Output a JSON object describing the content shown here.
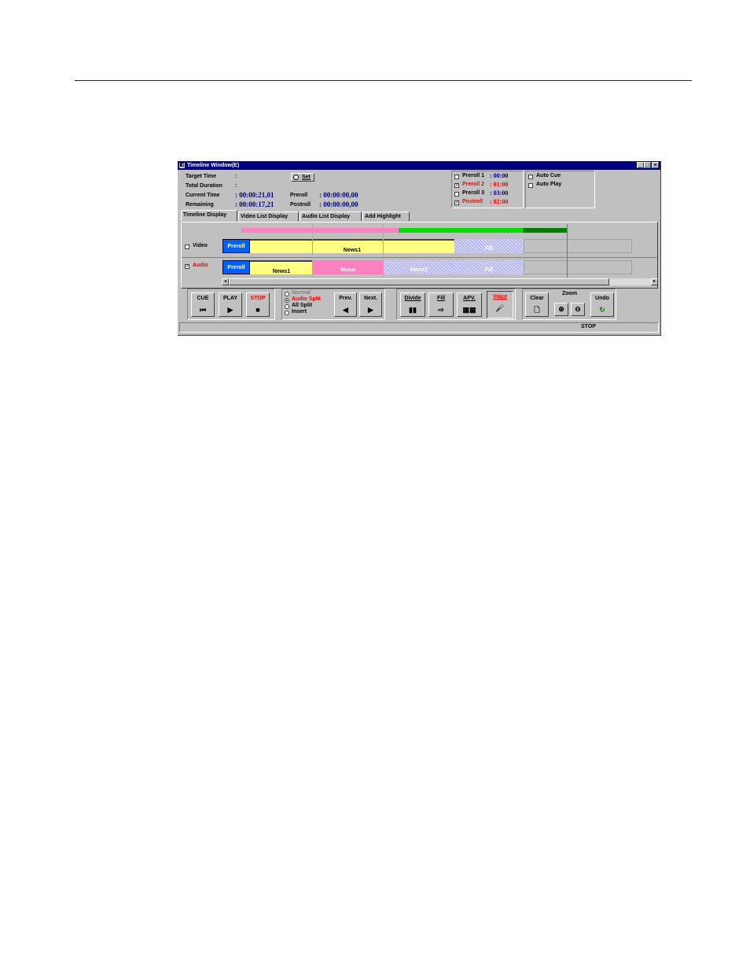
{
  "window": {
    "title": "Timeline Window(E)",
    "min": "_",
    "max": "□",
    "close": "×"
  },
  "info": {
    "target_time_label": "Target Time",
    "total_duration_label": "Total Duration",
    "current_time_label": "Current Time",
    "remaining_label": "Remaining",
    "colon": ":",
    "current_time_value": ": 00:00:21,01",
    "remaining_value": ": 00:00:17,21",
    "preroll_label": "Preroll",
    "postroll_label": "Postroll",
    "preroll_value": ": 00:00:00,00",
    "postroll_value": ": 00:00:00,00",
    "set_button": "Set"
  },
  "prerolls": [
    {
      "label": "Preroll 1",
      "value": ": 00:00",
      "checked": false,
      "color": "#000000",
      "value_color": "#000080"
    },
    {
      "label": "Preroll 2",
      "value": ": 01:00",
      "checked": true,
      "color": "#ff0000",
      "value_color": "#ff0000"
    },
    {
      "label": "Preroll 3",
      "value": ": 03:00",
      "checked": false,
      "color": "#000000",
      "value_color": "#000080"
    },
    {
      "label": "Postroll",
      "value": ": 02:00",
      "checked": true,
      "color": "#ff0000",
      "value_color": "#ff0000"
    }
  ],
  "auto": {
    "cue": "Auto Cue",
    "play": "Auto Play"
  },
  "tabs": [
    "Timeline Display",
    "Video List Display",
    "Audio List Display",
    "Add Highlight"
  ],
  "tracks": {
    "video": {
      "label": "Video",
      "checked": false,
      "preroll": "Preroll",
      "clip1": "News1",
      "clip2": "Fill"
    },
    "audio": {
      "label": "Audio",
      "checked": true,
      "preroll": "Preroll",
      "clip1": "News1",
      "clip2": "Music",
      "clip3": "News1",
      "clip4": "Fill"
    }
  },
  "scroll": {
    "left": "◂",
    "right": "▸"
  },
  "toolbar": {
    "cue": "CUE",
    "cue_icon": "⏮",
    "play": "PLAY",
    "play_icon": "▶",
    "stop": "STOP",
    "stop_icon": "■",
    "modes": [
      "Normal",
      "Audio Split",
      "All Split",
      "Insert"
    ],
    "prev": "Prev.",
    "prev_icon": "◀",
    "next": "Next.",
    "next_icon": "▶",
    "divide": "Divide",
    "divide_icon": "▮▮",
    "fill": "Fill",
    "fill_icon": "⇨",
    "apv": "APV.",
    "apv_icon": "▦▦",
    "voice": "Voice",
    "voice_icon": "🎤",
    "clear": "Clear",
    "clear_icon": "🗋",
    "zoom": "Zoom",
    "zoom_in_icon": "⊕",
    "zoom_out_icon": "⊖",
    "undo": "Undo",
    "undo_icon": "↻"
  },
  "status": {
    "text": "STOP"
  },
  "colors": {
    "stop": "#ff0000",
    "audio_label": "#ff0000",
    "voice": "#ff0000",
    "audio_split": "#ff0000",
    "normal": "#808080"
  }
}
